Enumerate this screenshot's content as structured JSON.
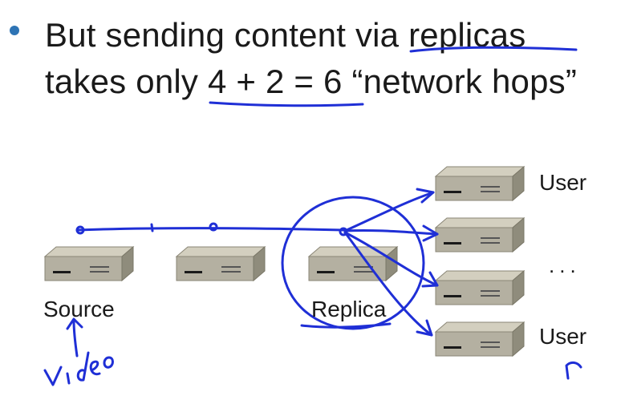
{
  "slide": {
    "bullet_line1": "But sending content via replicas",
    "bullet_line2": "takes only 4 + 2 = 6 “network hops”"
  },
  "diagram": {
    "labels": {
      "source": "Source",
      "replica": "Replica",
      "user_top": "User",
      "user_bottom": "User",
      "ellipsis": "..."
    },
    "annotation_handwritten": "video"
  },
  "colors": {
    "bullet": "#2e74b5",
    "ink": "#1f2fd6",
    "server_top": "#c8c4b4",
    "server_front": "#a9a596",
    "server_side": "#8c8979"
  }
}
